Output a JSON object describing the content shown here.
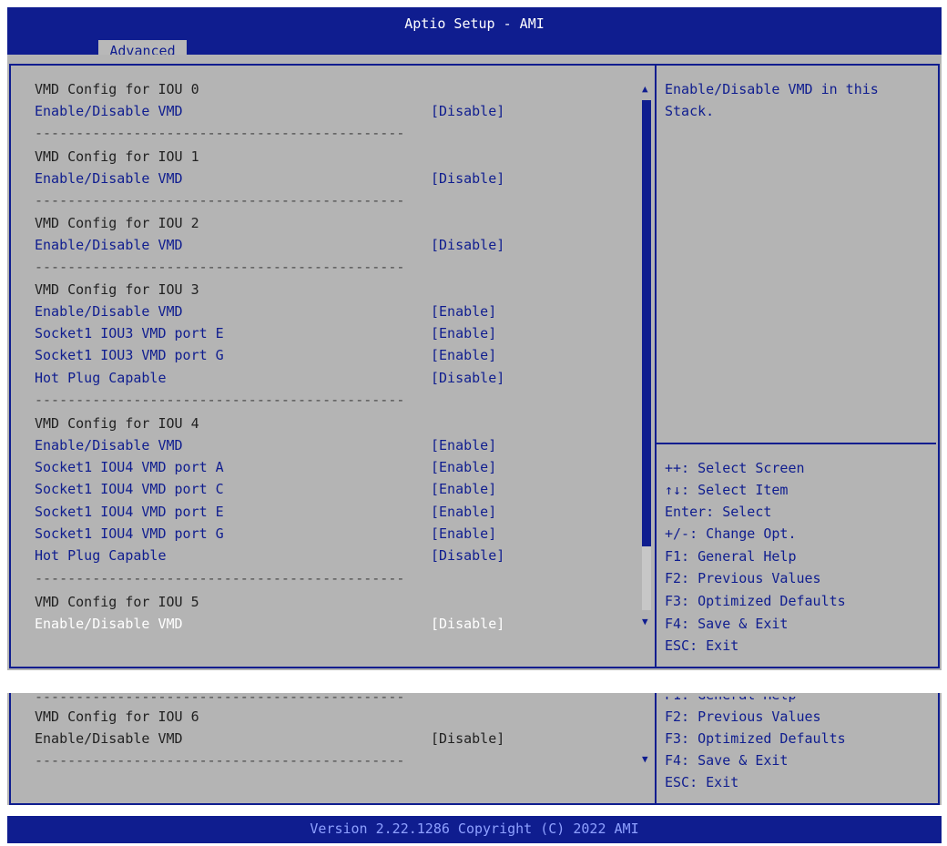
{
  "header": {
    "title": "Aptio Setup - AMI",
    "tab": "Advanced"
  },
  "menu": {
    "iou0_heading": "VMD Config for IOU 0",
    "iou0_vmd_label": "Enable/Disable VMD",
    "iou0_vmd_value": "[Disable]",
    "iou1_heading": "VMD Config for IOU 1",
    "iou1_vmd_label": "Enable/Disable VMD",
    "iou1_vmd_value": "[Disable]",
    "iou2_heading": "VMD Config for IOU 2",
    "iou2_vmd_label": "Enable/Disable VMD",
    "iou2_vmd_value": "[Disable]",
    "iou3_heading": "VMD Config for IOU 3",
    "iou3_vmd_label": "Enable/Disable VMD",
    "iou3_vmd_value": "[Enable]",
    "iou3_port_e_label": "Socket1 IOU3 VMD port E",
    "iou3_port_e_value": "[Enable]",
    "iou3_port_g_label": "Socket1 IOU3 VMD port G",
    "iou3_port_g_value": "[Enable]",
    "iou3_hotplug_label": "Hot Plug Capable",
    "iou3_hotplug_value": "[Disable]",
    "iou4_heading": "VMD Config for IOU 4",
    "iou4_vmd_label": "Enable/Disable VMD",
    "iou4_vmd_value": "[Enable]",
    "iou4_port_a_label": "Socket1 IOU4 VMD port A",
    "iou4_port_a_value": "[Enable]",
    "iou4_port_c_label": "Socket1 IOU4 VMD port C",
    "iou4_port_c_value": "[Enable]",
    "iou4_port_e_label": "Socket1 IOU4 VMD port E",
    "iou4_port_e_value": "[Enable]",
    "iou4_port_g_label": "Socket1 IOU4 VMD port G",
    "iou4_port_g_value": "[Enable]",
    "iou4_hotplug_label": "Hot Plug Capable",
    "iou4_hotplug_value": "[Disable]",
    "iou5_heading": "VMD Config for IOU 5",
    "iou5_vmd_label": "Enable/Disable VMD",
    "iou5_vmd_value": "[Disable]",
    "iou6_heading": "VMD Config for IOU 6",
    "iou6_vmd_label": "Enable/Disable VMD",
    "iou6_vmd_value": "[Disable]",
    "separator": "---------------------------------------------"
  },
  "help": {
    "description": "Enable/Disable VMD in this Stack.",
    "keys": {
      "select_screen": "++: Select Screen",
      "select_item": "↑↓: Select Item",
      "enter": "Enter: Select",
      "change": "+/-: Change Opt.",
      "f1": "F1: General Help",
      "f2": "F2: Previous Values",
      "f3": "F3: Optimized Defaults",
      "f4": "F4: Save & Exit",
      "esc": "ESC: Exit"
    }
  },
  "footer": {
    "version": "Version 2.22.1286 Copyright (C) 2022 AMI"
  },
  "colors": {
    "bios_blue": "#0f1d8f",
    "panel_gray": "#b4b4b4"
  }
}
